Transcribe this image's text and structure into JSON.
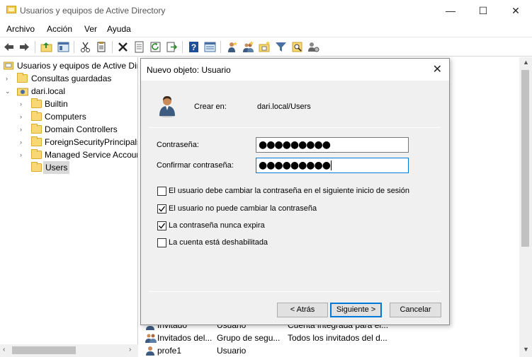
{
  "window": {
    "title": "Usuarios y equipos de Active Directory",
    "minimize": "—",
    "maximize": "☐",
    "close": "✕"
  },
  "menu": [
    "Archivo",
    "Acción",
    "Ver",
    "Ayuda"
  ],
  "toolbar_icons": [
    "back-arrow-icon",
    "forward-arrow-icon",
    "up-folder-icon",
    "show-tree-icon",
    "cut-icon",
    "copy-icon",
    "delete-icon",
    "properties-icon",
    "refresh-icon",
    "export-icon",
    "help-icon",
    "console-icon",
    "new-user-icon",
    "new-group-icon",
    "new-ou-icon",
    "filter-icon",
    "find-icon",
    "delegate-icon"
  ],
  "tree": {
    "root": "Usuarios y equipos de Active Dir",
    "saved_queries": "Consultas guardadas",
    "domain": "dari.local",
    "children": [
      "Builtin",
      "Computers",
      "Domain Controllers",
      "ForeignSecurityPrincipals",
      "Managed Service Accoun",
      "Users"
    ]
  },
  "list": {
    "rows": [
      {
        "name": "Invitado",
        "type": "Usuario",
        "desc": "Cuenta integrada para el..."
      },
      {
        "name": "Invitados del...",
        "type": "Grupo de segu...",
        "desc": "Todos los invitados del d..."
      },
      {
        "name": "profe1",
        "type": "Usuario",
        "desc": ""
      }
    ]
  },
  "dialog": {
    "title": "Nuevo objeto: Usuario",
    "close": "✕",
    "create_in_label": "Crear en:",
    "create_in_value": "dari.local/Users",
    "password_label": "Contraseña:",
    "password_value": "●●●●●●●●●",
    "confirm_label": "Confirmar contraseña:",
    "confirm_value": "●●●●●●●●●",
    "options": [
      {
        "label": "El usuario debe cambiar la contraseña en el siguiente inicio de sesión",
        "checked": false
      },
      {
        "label": "El usuario no puede cambiar la contraseña",
        "checked": true
      },
      {
        "label": "La contraseña nunca expira",
        "checked": true
      },
      {
        "label": "La cuenta está deshabilitada",
        "checked": false
      }
    ],
    "back_label": "< Atrás",
    "next_label": "Siguiente >",
    "cancel_label": "Cancelar"
  },
  "colors": {
    "accent": "#0078d7",
    "folder": "#f8d775"
  }
}
